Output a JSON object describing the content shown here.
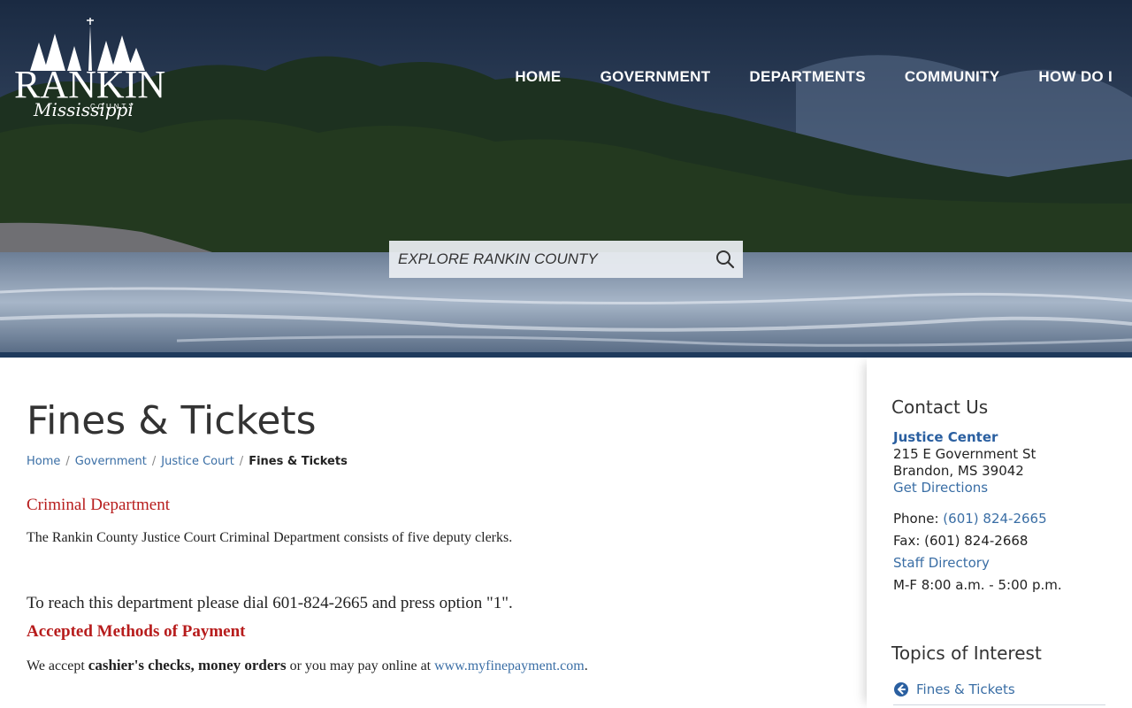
{
  "header": {
    "logo": {
      "word": "RANKIN",
      "county": "COUNTY",
      "state": "Mississippi"
    },
    "nav": [
      "HOME",
      "GOVERNMENT",
      "DEPARTMENTS",
      "COMMUNITY",
      "HOW DO I"
    ],
    "search": {
      "placeholder": "EXPLORE RANKIN COUNTY",
      "value": ""
    }
  },
  "main": {
    "title": "Fines & Tickets",
    "breadcrumb": {
      "items": [
        "Home",
        "Government",
        "Justice Court"
      ],
      "current": "Fines & Tickets",
      "separator": "/"
    },
    "criminal_heading": "Criminal Department",
    "criminal_text": "The Rankin County Justice Court Criminal Department consists of five deputy clerks.",
    "reach_text": "To reach this department please dial 601-824-2665 and press option \"1\".",
    "payment_heading": "Accepted Methods of Payment",
    "payment_text": {
      "prefix": "We accept ",
      "bold": "cashier's checks, money orders",
      "middle": " or you may pay online at ",
      "link": "www.myfinepayment.com",
      "suffix": "."
    }
  },
  "sidebar": {
    "contact_heading": "Contact Us",
    "office": "Justice Center",
    "address1": "215 E Government St",
    "address2": "Brandon, MS 39042",
    "directions": "Get Directions",
    "phone_label": "Phone: ",
    "phone": "(601) 824-2665",
    "fax": "Fax: (601) 824-2668",
    "staff_directory": "Staff Directory",
    "hours": "M-F 8:00 a.m. - 5:00 p.m.",
    "topics_heading": "Topics of Interest",
    "topics": [
      "Fines & Tickets"
    ]
  },
  "colors": {
    "accent_red": "#b71c1c",
    "link_blue": "#3a6ea5",
    "band_navy": "#1f3a5c"
  }
}
